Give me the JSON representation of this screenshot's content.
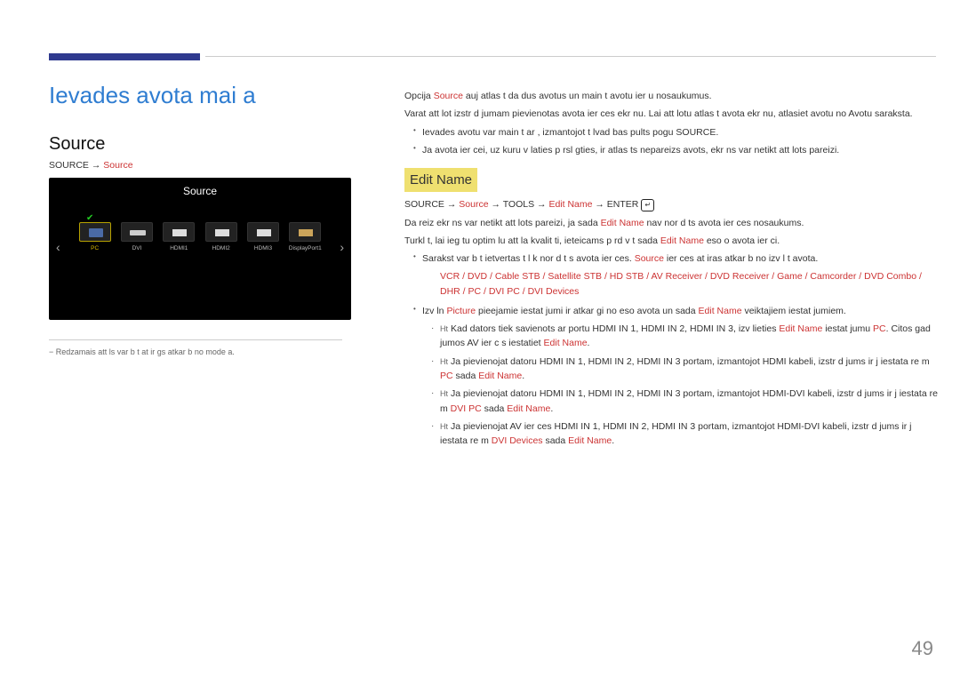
{
  "page_number": "49",
  "left": {
    "title": "Ievades avota mai a",
    "section": "Source",
    "path_pre": "SOURCE → ",
    "path_hi": "Source",
    "tv": {
      "title": "Source",
      "arrow_l": "‹",
      "arrow_r": "›",
      "items": [
        {
          "label": "PC",
          "glyph": "pc",
          "active": true,
          "check": true
        },
        {
          "label": "DVI",
          "glyph": "dvi"
        },
        {
          "label": "HDMI1",
          "glyph": "hdmi"
        },
        {
          "label": "HDMI2",
          "glyph": "hdmi"
        },
        {
          "label": "HDMI3",
          "glyph": "hdmi"
        },
        {
          "label": "DisplayPort1",
          "glyph": "dp"
        }
      ]
    },
    "footnote": "− Redzamais att ls var b t at  ir gs atkar b  no mode a."
  },
  "right": {
    "p1a": "Opcija ",
    "p1_src": "Source",
    "p1b": " auj atlas t da  dus avotus un main t avotu ier  u nosaukumus.",
    "p2": "Varat att lot izstr d jumam pievienotas avota ier ces ekr nu. Lai att lotu atlas t  avota ekr nu, atlasiet avotu no Avotu saraksta.",
    "b1": "Ievades avotu var main t ar , izmantojot t lvad bas pults pogu SOURCE.",
    "b2": "Ja avota ier cei, uz kuru v laties p rsl gties, ir atlas ts nepareizs avots, ekr ns var netikt att lots pareizi.",
    "sub2": "Edit Name",
    "path2_a": "SOURCE → ",
    "path2_src": "Source",
    "path2_b": " → TOOLS → ",
    "path2_en": "Edit Name",
    "path2_c": " → ENTER ",
    "p3a": "Da reiz ekr ns var netikt att lots pareizi, ja sada   ",
    "p3_en": "Edit Name",
    "p3b": " nav nor d ts avota ier ces nosaukums.",
    "p4a": "Turkl t, lai ieg tu optim lu att la kvalit ti, ieteicams p rd v t sada  ",
    "p4_en": "Edit Name",
    "p4b": " eso o avota ier ci.",
    "b3a": "Sarakst  var b t ietvertas t l k nor d t s avota ier ces. ",
    "b3_src": "Source",
    "b3b": " ier ces at  iras atkar b  no izv l t  avota.",
    "options": "VCR / DVD / Cable STB / Satellite STB / HD STB / AV Receiver / DVD Receiver / Game / Camcorder / DVD Combo / DHR / PC / DVI PC / DVI Devices",
    "b4a": "Izv ln  ",
    "b4_pic": "Picture",
    "b4b": " pieejamie iestat jumi ir atkar gi no eso   avota un sada   ",
    "b4_en": "Edit Name",
    "b4c": " veiktajiem iestat jumiem.",
    "ht": "Ht",
    "n1a": "Kad dators tiek savienots ar portu HDMI IN 1, HDMI IN 2, HDMI IN 3, izv lieties ",
    "n1_en": "Edit Name",
    "n1b": " iestat jumu ",
    "n1_pc": "PC",
    "n1c": ". Citos gad jumos AV ier c s iestatiet ",
    "n1_en2": "Edit Name",
    "n1d": ".",
    "n2a": "Ja pievienojat datoru HDMI IN 1, HDMI IN 2, HDMI IN 3 portam, izmantojot HDMI kabeli, izstr d jums ir j iestata re  m  ",
    "n2_pc": "PC",
    "n2b": " sada   ",
    "n2_en": "Edit Name",
    "n2c": ".",
    "n3a": "Ja pievienojat datoru HDMI IN 1, HDMI IN 2, HDMI IN 3 portam, izmantojot HDMI-DVI kabeli, izstr d jums ir j iestata re  m  ",
    "n3_pc": "DVI PC",
    "n3b": " sada   ",
    "n3_en": "Edit Name",
    "n3c": ".",
    "n4a": "Ja pievienojat AV ier ces HDMI IN 1, HDMI IN 2, HDMI IN 3 portam, izmantojot HDMI-DVI kabeli, izstr d jums ir j iestata re  m  ",
    "n4_pc": "DVI Devices",
    "n4b": " sada   ",
    "n4_en": "Edit Name",
    "n4c": "."
  }
}
